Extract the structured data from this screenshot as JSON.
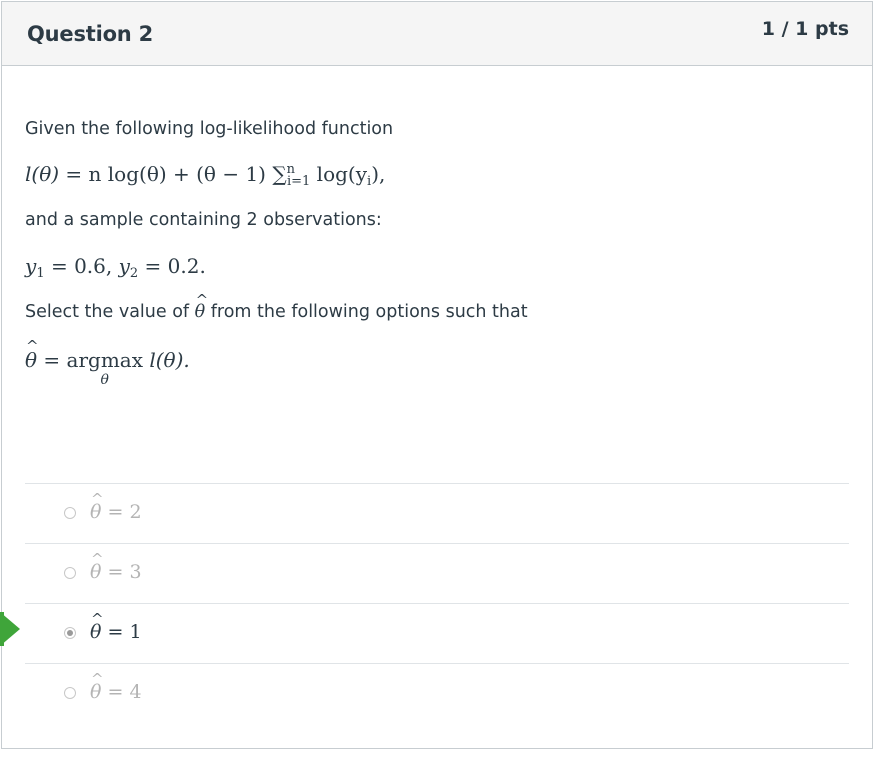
{
  "question": {
    "title": "Question 2",
    "points": "1 / 1 pts",
    "intro": "Given the following log-likelihood function",
    "formula": {
      "lhs": "l(θ)",
      "eq": " = ",
      "part1": "n log(θ) + (θ − 1) ",
      "sum_symbol": "∑",
      "sum_sub": "i=1",
      "sum_sup": "n",
      "part2": " log(y",
      "part2_sub": "i",
      "part2_end": "),"
    },
    "sample_text": "and a sample containing 2 observations:",
    "observations": {
      "y1_label": "y",
      "y1_sub": "1",
      "y1_val": " = 0.6, ",
      "y2_label": "y",
      "y2_sub": "2",
      "y2_val": " = 0.2."
    },
    "select_prefix": "Select the value of ",
    "select_theta": "θ",
    "select_suffix": " from the following options such that",
    "argmax": {
      "theta": "θ",
      "eq": " = ",
      "word": "argmax",
      "under": "θ",
      "rest": " l(θ)."
    }
  },
  "answers": [
    {
      "theta": "θ",
      "value": " = 2",
      "selected": false
    },
    {
      "theta": "θ",
      "value": " = 3",
      "selected": false
    },
    {
      "theta": "θ",
      "value": " = 1",
      "selected": true
    },
    {
      "theta": "θ",
      "value": " = 4",
      "selected": false
    }
  ],
  "colors": {
    "correct_flag": "#3fa53a",
    "text": "#2d3b45",
    "unselected_answer": "#b4b4b4"
  }
}
